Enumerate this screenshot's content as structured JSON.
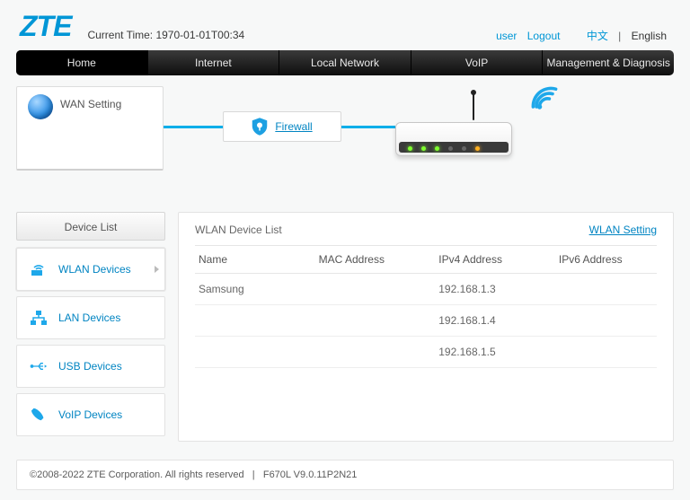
{
  "brand": "ZTE",
  "time_label": "Current Time: 1970-01-01T00:34",
  "top_links": {
    "user": "user",
    "logout": "Logout",
    "zh": "中文",
    "en": "English"
  },
  "nav": [
    "Home",
    "Internet",
    "Local Network",
    "VoIP",
    "Management & Diagnosis"
  ],
  "wan": {
    "title": "WAN Setting"
  },
  "firewall": {
    "label": "Firewall"
  },
  "sidebar": {
    "header": "Device List",
    "items": [
      {
        "label": "WLAN Devices"
      },
      {
        "label": "LAN Devices"
      },
      {
        "label": "USB Devices"
      },
      {
        "label": "VoIP Devices"
      }
    ]
  },
  "content": {
    "title": "WLAN Device List",
    "setting_link": "WLAN Setting",
    "columns": [
      "Name",
      "MAC Address",
      "IPv4 Address",
      "IPv6 Address"
    ],
    "rows": [
      {
        "name": "Samsung",
        "mac": "",
        "ipv4": "192.168.1.3",
        "ipv6": ""
      },
      {
        "name": "",
        "mac": "",
        "ipv4": "192.168.1.4",
        "ipv6": ""
      },
      {
        "name": "",
        "mac": "",
        "ipv4": "192.168.1.5",
        "ipv6": ""
      }
    ]
  },
  "footer": {
    "copyright": "©2008-2022 ZTE Corporation. All rights reserved",
    "version": "F670L V9.0.11P2N21"
  }
}
